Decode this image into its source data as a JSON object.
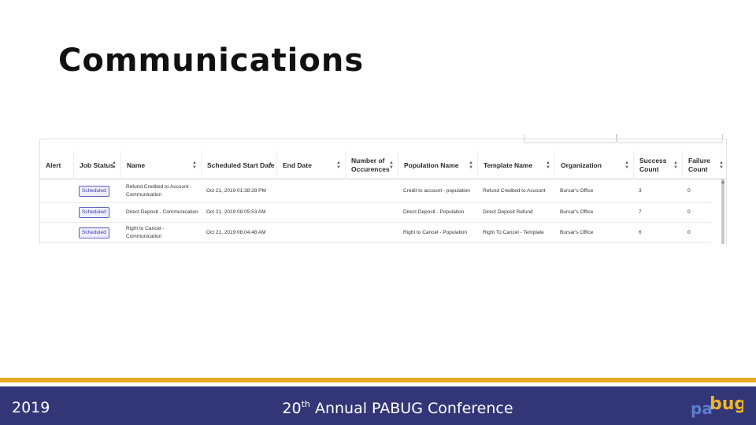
{
  "slide": {
    "title": "Communications"
  },
  "table": {
    "headers": [
      {
        "label": "Alert",
        "sortable": false
      },
      {
        "label": "Job Status",
        "sortable": true
      },
      {
        "label": "Name",
        "sortable": true
      },
      {
        "label": "Scheduled Start Date",
        "sortable": true,
        "sort": "asc"
      },
      {
        "label": "End Date",
        "sortable": true
      },
      {
        "label": "Number of\nOccurences",
        "sortable": true
      },
      {
        "label": "Population Name",
        "sortable": true
      },
      {
        "label": "Template Name",
        "sortable": true
      },
      {
        "label": "Organization",
        "sortable": true
      },
      {
        "label": "Success\nCount",
        "sortable": true
      },
      {
        "label": "Failure\nCount",
        "sortable": true
      }
    ],
    "rows": [
      {
        "alert": "",
        "status": "Scheduled",
        "name": "Refund Credited to Account -\nCommunication",
        "start": "Oct 21, 2019 01:38:28 PM",
        "end": "",
        "occurrences": "",
        "population": "Credit to account - population",
        "template": "Refund Credited to Account",
        "organization": "Bursar's Office",
        "success": "3",
        "failure": "0"
      },
      {
        "alert": "",
        "status": "Scheduled",
        "name": "Direct Deposit - Communication",
        "start": "Oct 21, 2019 08:05:53 AM",
        "end": "",
        "occurrences": "",
        "population": "Direct Deposit - Population",
        "template": "Direct Deposit Refund",
        "organization": "Bursar's Office",
        "success": "7",
        "failure": "0"
      },
      {
        "alert": "",
        "status": "Scheduled",
        "name": "Right to Cancel - Communication",
        "start": "Oct 21, 2019 08:04:48 AM",
        "end": "",
        "occurrences": "",
        "population": "Right to Cancel - Population",
        "template": "Right To Cancel - Template",
        "organization": "Bursar's Office",
        "success": "6",
        "failure": "0"
      }
    ]
  },
  "footer": {
    "year": "2019",
    "conference_ordinal": "20",
    "conference_suffix": "th",
    "conference_rest": " Annual PABUG Conference",
    "logo_text_left": "pa",
    "logo_text_right": "bug",
    "accent_color": "#e8a824",
    "bar_color": "#333676"
  }
}
